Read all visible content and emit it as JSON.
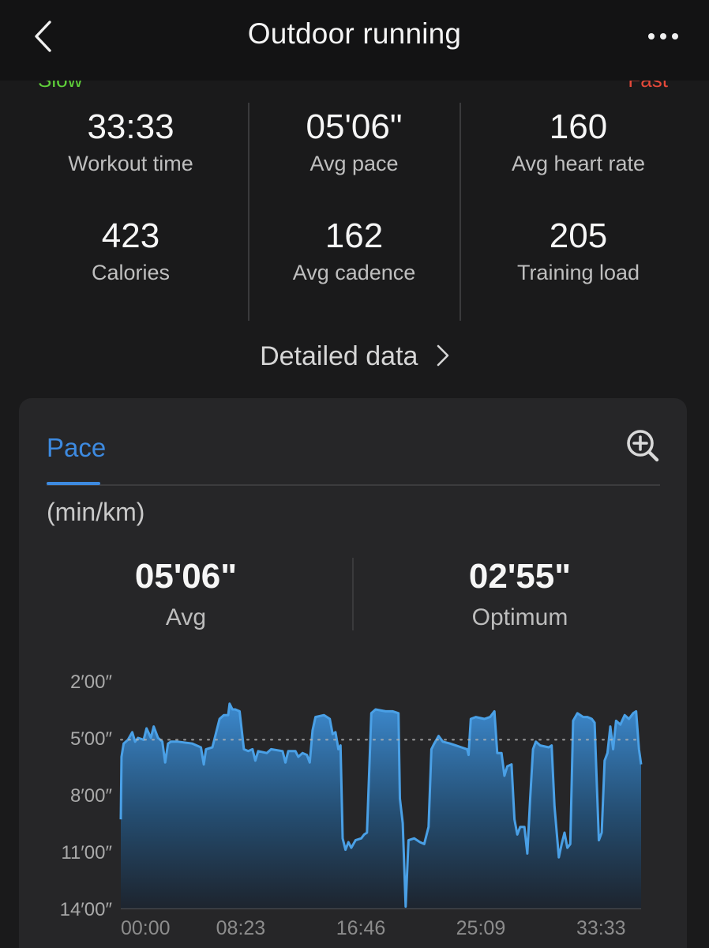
{
  "header": {
    "title": "Outdoor running",
    "back_icon": "chevron-left-icon",
    "more_icon": "more-horizontal-icon",
    "slow_label_partial": "Slow",
    "fast_label_partial": "Fast"
  },
  "stats": [
    {
      "value": "33:33",
      "label": "Workout time"
    },
    {
      "value": "05'06\"",
      "label": "Avg pace"
    },
    {
      "value": "160",
      "label": "Avg heart rate"
    },
    {
      "value": "423",
      "label": "Calories"
    },
    {
      "value": "162",
      "label": "Avg cadence"
    },
    {
      "value": "205",
      "label": "Training load"
    }
  ],
  "detailed_link": "Detailed data",
  "pace_card": {
    "tab_label": "Pace",
    "zoom_icon": "zoom-in-icon",
    "unit": "(min/km)",
    "summary": [
      {
        "value": "05'06\"",
        "label": "Avg"
      },
      {
        "value": "02'55\"",
        "label": "Optimum"
      }
    ]
  },
  "colors": {
    "accent": "#3d8ae0",
    "line": "#4aa0e6",
    "slow": "#5fd03a",
    "fast": "#e5493a"
  },
  "chart_data": {
    "type": "area",
    "title": "Pace",
    "ylabel": "(min/km)",
    "y_inverted": true,
    "ylim": [
      2,
      14
    ],
    "y_ticks": [
      "2′00″",
      "5′00″",
      "8′00″",
      "11′00″",
      "14′00″"
    ],
    "y_tick_values": [
      2,
      5,
      8,
      11,
      14
    ],
    "x_ticks": [
      "00:00",
      "08:23",
      "16:46",
      "25:09",
      "33:33"
    ],
    "x_tick_values": [
      0,
      8.38,
      16.77,
      25.15,
      33.55
    ],
    "avg_line": 5.1,
    "series": [
      {
        "points": [
          [
            0.0,
            9.3
          ],
          [
            0.05,
            6.0
          ],
          [
            0.2,
            5.3
          ],
          [
            0.5,
            5.1
          ],
          [
            0.8,
            4.7
          ],
          [
            1.0,
            5.2
          ],
          [
            1.2,
            5.0
          ],
          [
            1.6,
            5.1
          ],
          [
            1.8,
            4.5
          ],
          [
            2.1,
            5.0
          ],
          [
            2.3,
            4.4
          ],
          [
            2.6,
            5.0
          ],
          [
            2.9,
            5.2
          ],
          [
            3.1,
            6.3
          ],
          [
            3.3,
            5.3
          ],
          [
            3.5,
            5.2
          ],
          [
            4.0,
            5.2
          ],
          [
            5.0,
            5.3
          ],
          [
            5.6,
            5.5
          ],
          [
            5.8,
            6.4
          ],
          [
            5.95,
            5.6
          ],
          [
            6.4,
            5.5
          ],
          [
            6.9,
            4.0
          ],
          [
            7.2,
            3.8
          ],
          [
            7.5,
            3.8
          ],
          [
            7.6,
            3.2
          ],
          [
            7.8,
            3.5
          ],
          [
            8.0,
            3.5
          ],
          [
            8.3,
            3.6
          ],
          [
            8.6,
            5.6
          ],
          [
            8.9,
            5.7
          ],
          [
            9.2,
            5.6
          ],
          [
            9.4,
            6.2
          ],
          [
            9.6,
            5.7
          ],
          [
            10.2,
            5.8
          ],
          [
            10.5,
            5.6
          ],
          [
            11.3,
            5.7
          ],
          [
            11.5,
            6.3
          ],
          [
            11.7,
            5.7
          ],
          [
            12.2,
            5.7
          ],
          [
            12.4,
            6.0
          ],
          [
            12.7,
            5.8
          ],
          [
            13.0,
            5.9
          ],
          [
            13.2,
            6.3
          ],
          [
            13.4,
            4.6
          ],
          [
            13.6,
            3.9
          ],
          [
            14.2,
            3.8
          ],
          [
            14.6,
            4.0
          ],
          [
            14.8,
            4.8
          ],
          [
            15.0,
            4.7
          ],
          [
            15.2,
            5.6
          ],
          [
            15.35,
            5.4
          ],
          [
            15.5,
            10.3
          ],
          [
            15.7,
            10.9
          ],
          [
            15.9,
            10.5
          ],
          [
            16.1,
            10.8
          ],
          [
            16.4,
            10.4
          ],
          [
            16.8,
            10.3
          ],
          [
            17.0,
            10.1
          ],
          [
            17.2,
            10.0
          ],
          [
            17.5,
            3.7
          ],
          [
            17.8,
            3.5
          ],
          [
            18.5,
            3.6
          ],
          [
            19.0,
            3.6
          ],
          [
            19.4,
            3.7
          ],
          [
            19.5,
            8.2
          ],
          [
            19.7,
            9.5
          ],
          [
            19.9,
            13.9
          ],
          [
            20.1,
            10.4
          ],
          [
            20.5,
            10.3
          ],
          [
            20.9,
            10.5
          ],
          [
            21.2,
            10.6
          ],
          [
            21.5,
            9.7
          ],
          [
            21.7,
            5.6
          ],
          [
            21.9,
            5.3
          ],
          [
            22.2,
            4.9
          ],
          [
            22.5,
            5.2
          ],
          [
            23.0,
            5.3
          ],
          [
            23.4,
            5.4
          ],
          [
            23.8,
            5.5
          ],
          [
            24.2,
            5.6
          ],
          [
            24.3,
            5.9
          ],
          [
            24.45,
            4.0
          ],
          [
            24.8,
            3.9
          ],
          [
            25.4,
            4.0
          ],
          [
            25.8,
            3.9
          ],
          [
            26.1,
            3.6
          ],
          [
            26.3,
            5.8
          ],
          [
            26.6,
            5.8
          ],
          [
            26.8,
            7.0
          ],
          [
            27.0,
            6.5
          ],
          [
            27.3,
            6.4
          ],
          [
            27.5,
            9.3
          ],
          [
            27.7,
            10.1
          ],
          [
            27.9,
            9.7
          ],
          [
            28.2,
            9.7
          ],
          [
            28.4,
            11.1
          ],
          [
            28.6,
            8.2
          ],
          [
            28.8,
            5.6
          ],
          [
            29.0,
            5.2
          ],
          [
            29.3,
            5.4
          ],
          [
            29.9,
            5.5
          ],
          [
            30.1,
            5.4
          ],
          [
            30.3,
            8.6
          ],
          [
            30.6,
            11.3
          ],
          [
            30.8,
            10.6
          ],
          [
            31.0,
            10.0
          ],
          [
            31.2,
            10.8
          ],
          [
            31.4,
            10.6
          ],
          [
            31.6,
            4.1
          ],
          [
            31.9,
            3.7
          ],
          [
            32.3,
            3.9
          ],
          [
            32.6,
            3.9
          ],
          [
            32.9,
            4.0
          ],
          [
            33.1,
            4.2
          ],
          [
            33.4,
            10.4
          ],
          [
            33.6,
            10.0
          ],
          [
            33.8,
            6.2
          ],
          [
            34.0,
            5.8
          ],
          [
            34.2,
            4.4
          ],
          [
            34.4,
            5.6
          ],
          [
            34.6,
            4.1
          ],
          [
            34.9,
            4.3
          ],
          [
            35.2,
            3.8
          ],
          [
            35.5,
            4.0
          ],
          [
            35.8,
            3.7
          ],
          [
            36.0,
            3.6
          ],
          [
            36.2,
            5.6
          ],
          [
            36.35,
            6.4
          ]
        ]
      }
    ]
  }
}
